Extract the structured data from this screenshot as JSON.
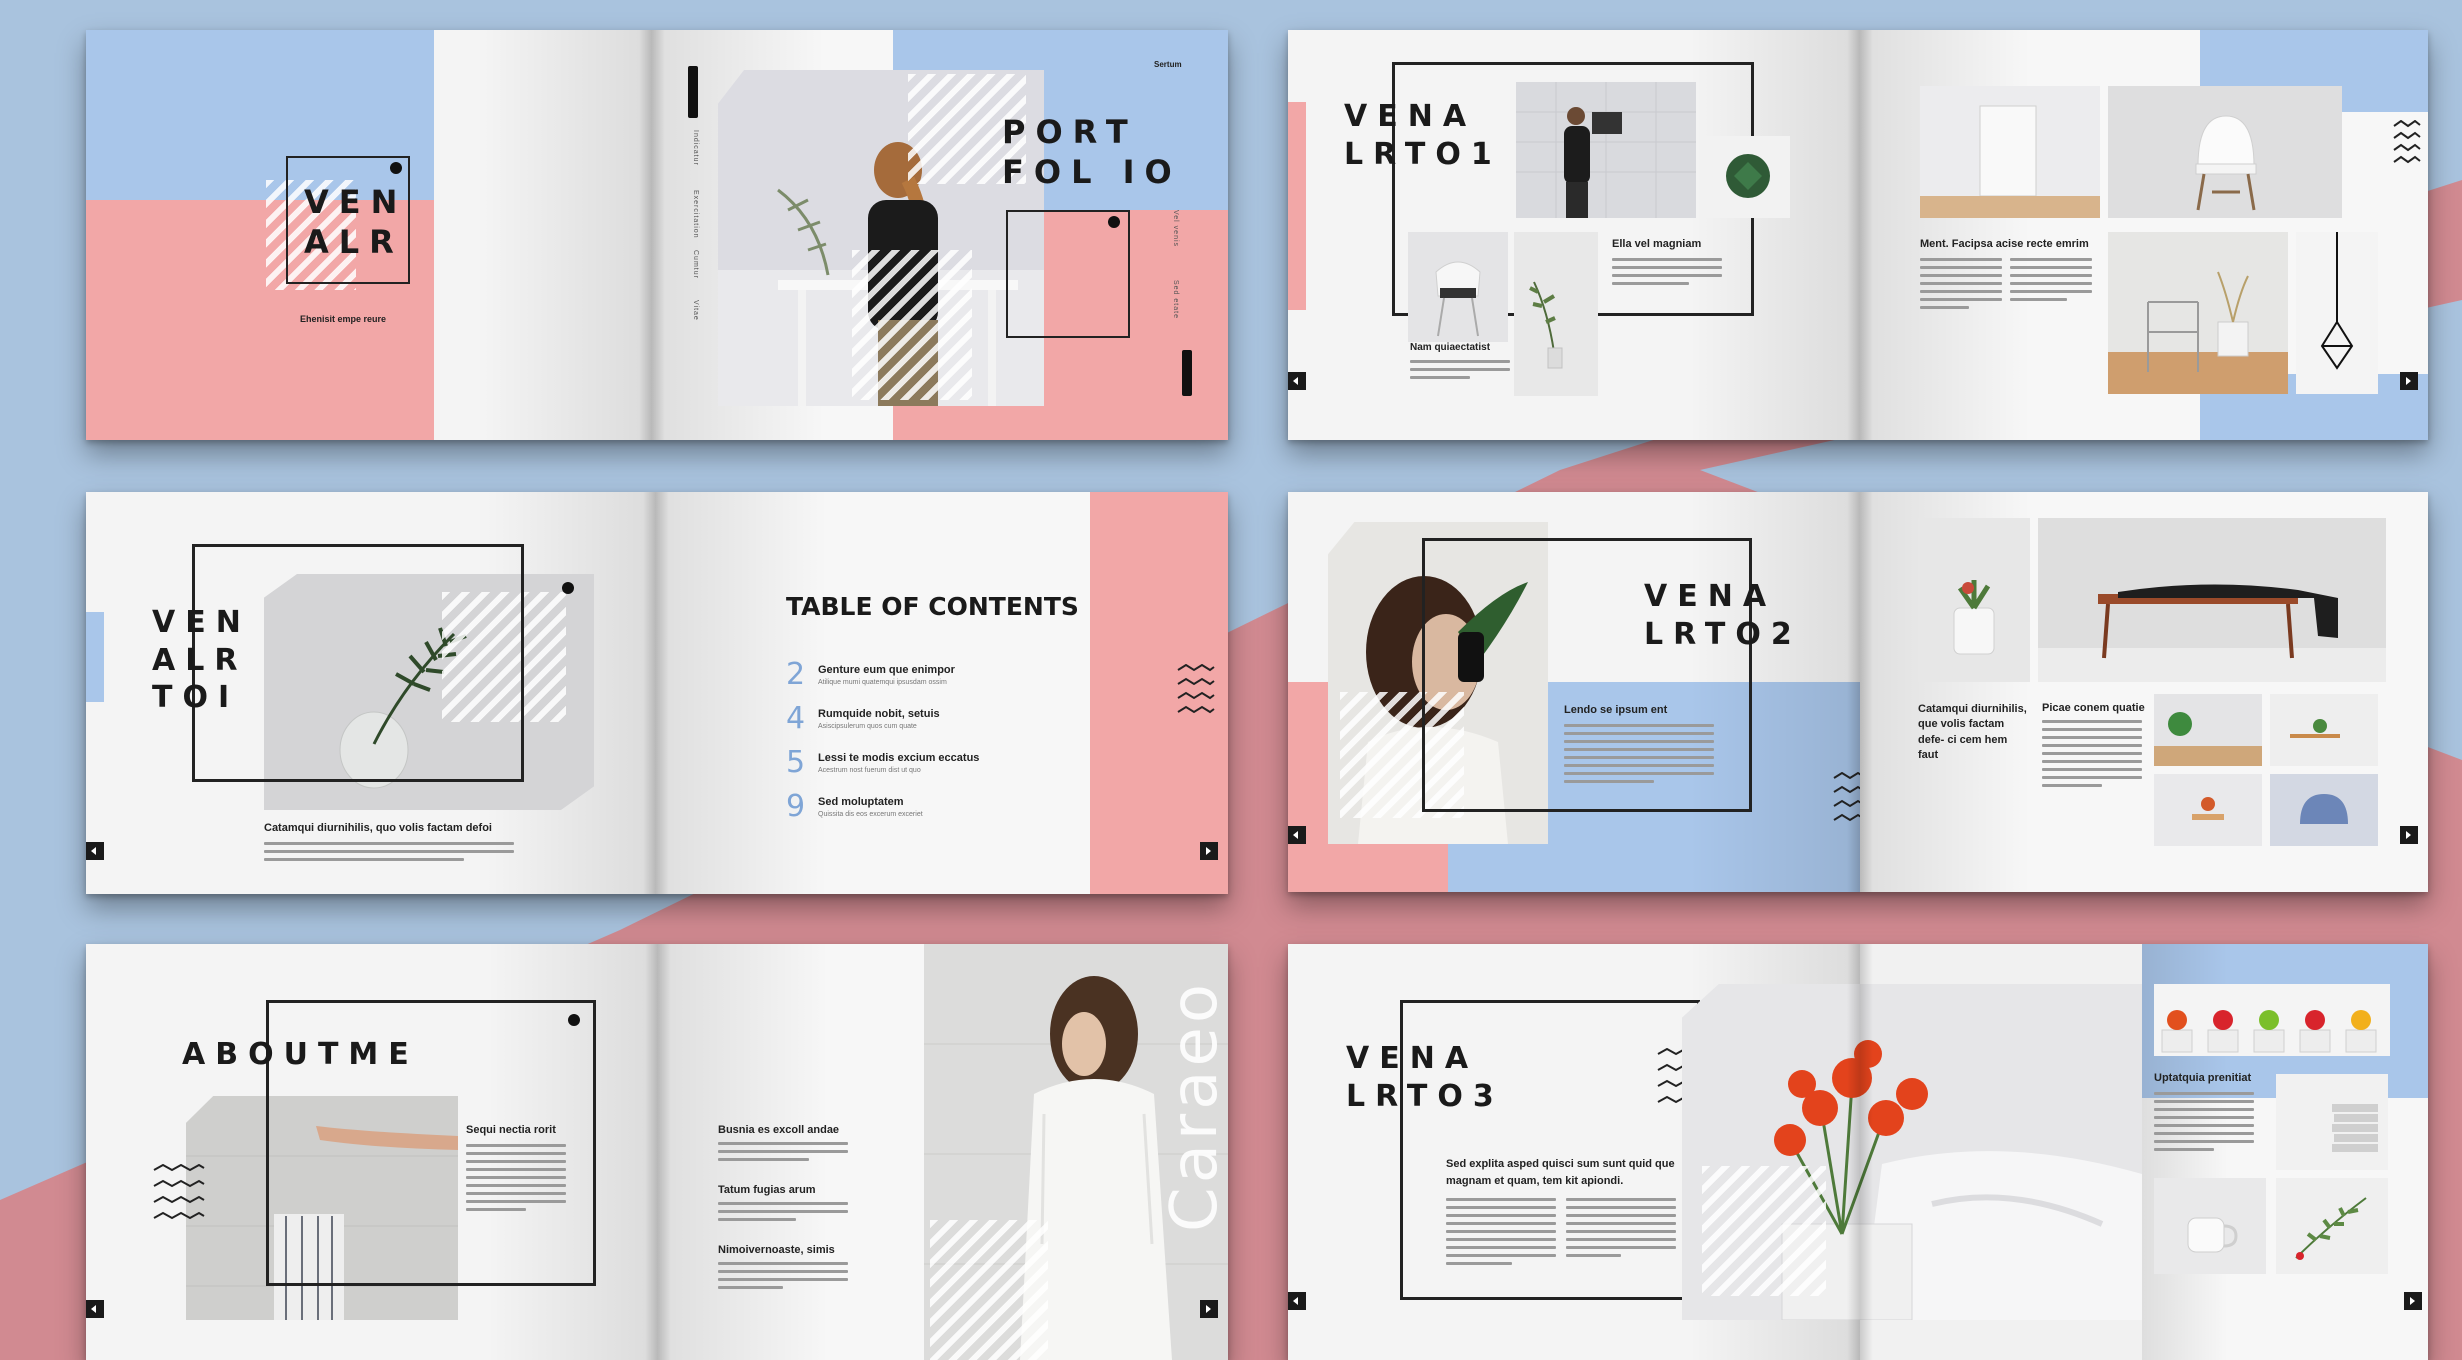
{
  "colors": {
    "pink": "#f2a7a7",
    "blue": "#a9c6ea",
    "dark": "#1a1a1a",
    "accent_number": "#7fa5d6"
  },
  "spread1": {
    "cover_title": "VEN\nALR",
    "cover_tagline": "Ehenisit empe reure",
    "portfolio_title": "PORT\nFOL IO",
    "corner_label": "Sertum",
    "vertical_labels": [
      "Indicatur",
      "Exercitation",
      "Cumtur",
      "Vitae",
      "Vel venis",
      "Sed etate"
    ]
  },
  "spread2": {
    "title": "VENA\nLRTO1",
    "caption_1": "Ella vel magniam",
    "caption_2": "Nam quiaectatist",
    "caption_3": "Ment. Facipsa acise recte emrim"
  },
  "spread3": {
    "title": "VEN\nALR\nTOI",
    "caption": "Catamqui diurnihilis, quo volis factam defoi",
    "toc_title": "TABLE OF CONTENTS",
    "toc_items": [
      {
        "number": "2",
        "label": "Genture eum que enimpor",
        "sub": "Atilique mumi quatemqui ipsusdam ossim"
      },
      {
        "number": "4",
        "label": "Rumquide nobit, setuis",
        "sub": "Asiscipsulerum quos cum quate"
      },
      {
        "number": "5",
        "label": "Lessi te modis excium eccatus",
        "sub": "Acestrum nost fuerum dist ut quo"
      },
      {
        "number": "9",
        "label": "Sed moluptatem",
        "sub": "Quissita dis eos excerum exceriet"
      }
    ]
  },
  "spread4": {
    "title": "VENA\nLRTO2",
    "caption_1": "Lendo se ipsum ent",
    "caption_2": "Catamqui diurnihilis, que volis factam defe- ci cem hem faut",
    "caption_3": "Picae conem quatie"
  },
  "spread5": {
    "title": "ABOUTME",
    "caption_1": "Sequi nectia rorit",
    "caption_2": "Busnia es excoll andae",
    "caption_3": "Tatum fugias arum",
    "caption_4": "Nimoivernoaste, simis",
    "vertical_word": "Caraeo"
  },
  "spread6": {
    "title": "VENA\nLRTO3",
    "intro": "Sed explita asped quisci sum sunt quid que magnam et quam, tem kit apiondi.",
    "caption": "Uptatquia prenitiat"
  },
  "icons": [
    "wave-lines-icon",
    "next-arrow-icon",
    "back-arrow-icon",
    "dot-icon"
  ]
}
